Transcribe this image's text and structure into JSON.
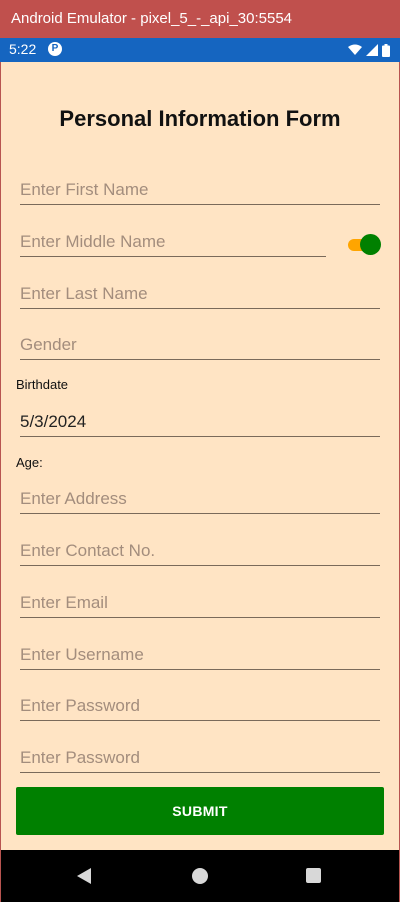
{
  "window": {
    "title": "Android Emulator - pixel_5_-_api_30:5554"
  },
  "status_bar": {
    "time": "5:22",
    "app_icon_letter": "P"
  },
  "form": {
    "title": "Personal Information Form",
    "first_name_placeholder": "Enter First Name",
    "middle_name_placeholder": "Enter Middle Name",
    "middle_name_toggle_on": true,
    "last_name_placeholder": "Enter Last Name",
    "gender_placeholder": "Gender",
    "birthdate_label": "Birthdate",
    "birthdate_value": "5/3/2024",
    "age_label": "Age:",
    "address_placeholder": "Enter Address",
    "contact_placeholder": "Enter Contact No.",
    "email_placeholder": "Enter Email",
    "username_placeholder": "Enter Username",
    "password_placeholder": "Enter Password",
    "confirm_password_placeholder": "Enter Password",
    "submit_label": "SUBMIT"
  },
  "colors": {
    "background": "#ffe4c4",
    "submit_button": "#008000",
    "toggle_thumb": "#008000",
    "toggle_track": "#ffa500",
    "status_bar": "#1565c0",
    "title_bar": "#c0504d"
  }
}
